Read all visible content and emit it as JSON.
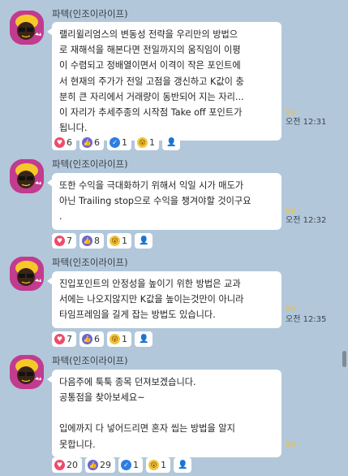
{
  "messages": [
    {
      "sender": "파텍(인조이라이프)",
      "lines": [
        "랠리윌리엄스의 변동성 전략을 우리만의 방법으",
        "로 재해석을 해본다면 전일까지의 움직임이 이평",
        "이 수렴되고 정배열이면서 이격이 작은 포인트에",
        "서 현재의 주가가 전일 고점을 갱신하고 K값이 충",
        "분히 큰 자리에서 거래량이 동반되어 지는 자리...",
        "이 자리가 추세주종의 시작점 Take off 포인트가",
        "됩니다."
      ],
      "unread": "99",
      "time": "오전 12:31",
      "reactions": [
        {
          "icon": "heart-icon",
          "glyph": "♥",
          "count": "6"
        },
        {
          "icon": "thumbs-up-icon",
          "glyph": "👍",
          "count": "6"
        },
        {
          "icon": "check-icon",
          "glyph": "✓",
          "count": "1"
        },
        {
          "icon": "surprised-face-icon",
          "glyph": "😮",
          "count": "1"
        },
        {
          "icon": "user-icon",
          "glyph": "👤",
          "count": ""
        }
      ]
    },
    {
      "sender": "파텍(인조이라이프)",
      "lines": [
        "또한 수익을 극대화하기 위해서 익일 시가 매도가",
        " 아닌 Trailing stop으로 수익을 챙겨야할 것이구요",
        "."
      ],
      "unread": "99",
      "time": "오전 12:32",
      "reactions": [
        {
          "icon": "heart-icon",
          "glyph": "♥",
          "count": "7"
        },
        {
          "icon": "thumbs-up-icon",
          "glyph": "👍",
          "count": "8"
        },
        {
          "icon": "surprised-face-icon",
          "glyph": "😮",
          "count": "1"
        },
        {
          "icon": "user-icon",
          "glyph": "👤",
          "count": ""
        }
      ]
    },
    {
      "sender": "파텍(인조이라이프)",
      "lines": [
        "진입포인트의 안정성을 높이기 위한 방법은 교과",
        "서에는 나오지않지만 K값을 높이는것만이 아니라",
        "타임프레임을 길게 잡는 방법도 있습니다."
      ],
      "unread": "99",
      "time": "오전 12:35",
      "reactions": [
        {
          "icon": "heart-icon",
          "glyph": "♥",
          "count": "7"
        },
        {
          "icon": "thumbs-up-icon",
          "glyph": "👍",
          "count": "6"
        },
        {
          "icon": "surprised-face-icon",
          "glyph": "😮",
          "count": "1"
        },
        {
          "icon": "user-icon",
          "glyph": "👤",
          "count": ""
        }
      ]
    },
    {
      "sender": "파텍(인조이라이프)",
      "lines": [
        "다음주에 툭툭 종목 던져보겠습니다.",
        "공통점을 찾아보세요~",
        "",
        "입에까지 다 넣어드리면 혼자 씹는 방법을 알지",
        "못합니다."
      ],
      "unread": "99",
      "time": "",
      "reactions": [
        {
          "icon": "heart-icon",
          "glyph": "♥",
          "count": "20"
        },
        {
          "icon": "thumbs-up-icon",
          "glyph": "👍",
          "count": "29"
        },
        {
          "icon": "check-icon",
          "glyph": "✓",
          "count": "1"
        },
        {
          "icon": "surprised-face-icon",
          "glyph": "😮",
          "count": "1"
        },
        {
          "icon": "user-icon",
          "glyph": "👤",
          "count": ""
        }
      ]
    }
  ]
}
